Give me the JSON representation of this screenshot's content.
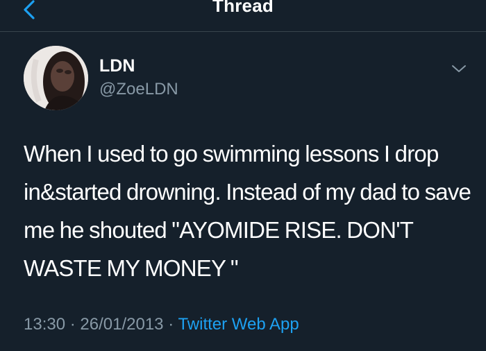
{
  "header": {
    "title": "Thread",
    "back_icon": "chevron-left-icon",
    "accent_color": "#1da1f2"
  },
  "tweet": {
    "display_name": "LDN",
    "handle": "@ZoeLDN",
    "avatar": "profile-avatar",
    "menu_icon": "chevron-down-icon",
    "text": "When I used to go swimming lessons I drop in&started drowning. Instead of my dad to save me he shouted \"AYOMIDE RISE. DON'T WASTE MY MONEY \"",
    "time": "13:30",
    "separator": "·",
    "date": "26/01/2013",
    "source": "Twitter Web App"
  },
  "colors": {
    "background": "#15202b",
    "text": "#ffffff",
    "secondary_text": "#8899a6",
    "link": "#1da1f2",
    "divider": "#38444d"
  }
}
